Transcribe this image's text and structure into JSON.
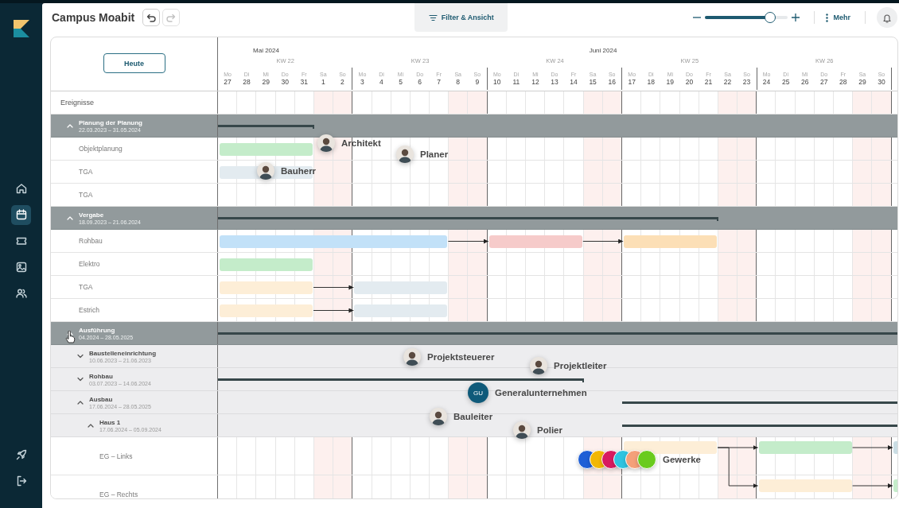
{
  "sidebar": {
    "items": [
      {
        "kind": "home",
        "selected": false
      },
      {
        "kind": "calendar",
        "selected": true
      },
      {
        "kind": "ticket",
        "selected": false
      },
      {
        "kind": "image",
        "selected": false
      },
      {
        "kind": "users",
        "selected": false
      }
    ],
    "bottom_items": [
      {
        "kind": "rocket"
      },
      {
        "kind": "logout"
      }
    ]
  },
  "toolbar": {
    "title": "Campus Moabit",
    "history_buttons": [
      {
        "kind": "undo",
        "disabled": false
      },
      {
        "kind": "redo",
        "disabled": true
      }
    ],
    "filter_button": "Filter & Ansicht",
    "zoom": {
      "level": 0.78
    },
    "more_button": "Mehr"
  },
  "gantt": {
    "today_button": "Heute",
    "months": [
      {
        "label": "Mai 2024"
      },
      {
        "label": "Juni 2024"
      }
    ],
    "weeks": [
      {
        "label": "KW 22",
        "days": [
          {
            "weekday": "Mo",
            "day": "27",
            "weekend": false
          },
          {
            "weekday": "Di",
            "day": "28",
            "weekend": false
          },
          {
            "weekday": "Mi",
            "day": "29",
            "weekend": false
          },
          {
            "weekday": "Do",
            "day": "30",
            "weekend": false
          },
          {
            "weekday": "Fr",
            "day": "31",
            "weekend": false
          },
          {
            "weekday": "Sa",
            "day": "1",
            "weekend": true
          },
          {
            "weekday": "So",
            "day": "2",
            "weekend": true
          }
        ]
      },
      {
        "label": "KW 23",
        "days": [
          {
            "weekday": "Mo",
            "day": "3",
            "weekend": false
          },
          {
            "weekday": "Di",
            "day": "4",
            "weekend": false
          },
          {
            "weekday": "Mi",
            "day": "5",
            "weekend": false
          },
          {
            "weekday": "Do",
            "day": "6",
            "weekend": false
          },
          {
            "weekday": "Fr",
            "day": "7",
            "weekend": false
          },
          {
            "weekday": "Sa",
            "day": "8",
            "weekend": true
          },
          {
            "weekday": "So",
            "day": "9",
            "weekend": true
          }
        ]
      },
      {
        "label": "KW 24",
        "days": [
          {
            "weekday": "Mo",
            "day": "10",
            "weekend": false
          },
          {
            "weekday": "Di",
            "day": "11",
            "weekend": false
          },
          {
            "weekday": "Mi",
            "day": "12",
            "weekend": false
          },
          {
            "weekday": "Do",
            "day": "13",
            "weekend": false
          },
          {
            "weekday": "Fr",
            "day": "14",
            "weekend": false
          },
          {
            "weekday": "Sa",
            "day": "15",
            "weekend": true
          },
          {
            "weekday": "So",
            "day": "16",
            "weekend": true
          }
        ]
      },
      {
        "label": "KW 25",
        "days": [
          {
            "weekday": "Mo",
            "day": "17",
            "weekend": false
          },
          {
            "weekday": "Di",
            "day": "18",
            "weekend": false
          },
          {
            "weekday": "Mi",
            "day": "19",
            "weekend": false
          },
          {
            "weekday": "Do",
            "day": "20",
            "weekend": false
          },
          {
            "weekday": "Fr",
            "day": "21",
            "weekend": false
          },
          {
            "weekday": "Sa",
            "day": "22",
            "weekend": true
          },
          {
            "weekday": "So",
            "day": "23",
            "weekend": true
          }
        ]
      },
      {
        "label": "KW 26",
        "days": [
          {
            "weekday": "Mo",
            "day": "24",
            "weekend": false
          },
          {
            "weekday": "Di",
            "day": "25",
            "weekend": false
          },
          {
            "weekday": "Mi",
            "day": "26",
            "weekend": false
          },
          {
            "weekday": "Do",
            "day": "27",
            "weekend": false
          },
          {
            "weekday": "Fr",
            "day": "28",
            "weekend": false
          },
          {
            "weekday": "Sa",
            "day": "29",
            "weekend": true
          },
          {
            "weekday": "So",
            "day": "30",
            "weekend": true
          }
        ]
      }
    ],
    "events_label": "Ereignisse",
    "rows": [
      {
        "kind": "group",
        "title": "Planung der Planung",
        "dates": "22.03.2023 – 31.05.2024",
        "expanded": true,
        "children": [
          {
            "kind": "task",
            "label": "Objektplanung",
            "bars": [
              {
                "color": "#c4ecca",
                "kind": "start"
              }
            ]
          },
          {
            "kind": "task",
            "label": "TGA",
            "bars": [
              {
                "color": "#e3ebf0",
                "kind": "start"
              }
            ]
          },
          {
            "kind": "task",
            "label": "TGA"
          }
        ]
      },
      {
        "kind": "group",
        "title": "Vergabe",
        "dates": "18.09.2023 – 21.06.2024",
        "expanded": true,
        "children": [
          {
            "kind": "task",
            "label": "Rohbau",
            "bars": [
              {
                "color": "#c2e1f8",
                "kind": "start"
              },
              {
                "color": "#f6cbca",
                "kind": "follow"
              },
              {
                "color": "#fcdfb6",
                "kind": "follow"
              }
            ]
          },
          {
            "kind": "task",
            "label": "Elektro",
            "bars": [
              {
                "color": "#c4ecca",
                "kind": "start"
              }
            ]
          },
          {
            "kind": "task",
            "label": "TGA",
            "bars": [
              {
                "color": "#fdeed7",
                "kind": "start"
              },
              {
                "color": "#e3ebf0",
                "kind": "follow"
              }
            ]
          },
          {
            "kind": "task",
            "label": "Estrich",
            "bars": [
              {
                "color": "#fdeed7",
                "kind": "start"
              },
              {
                "color": "#e3ebf0",
                "kind": "follow"
              }
            ]
          }
        ]
      },
      {
        "kind": "group",
        "title": "Ausführung",
        "dates": "04.2024 – 28.05.2025",
        "expanded": true,
        "children": [
          {
            "kind": "subgroup",
            "title": "Baustelleneinrichtung",
            "dates": "10.06.2023 – 21.06.2023",
            "expanded": false
          },
          {
            "kind": "subgroup",
            "title": "Rohbau",
            "dates": "03.07.2023 – 14.06.2024",
            "expanded": false
          },
          {
            "kind": "subgroup",
            "title": "Ausbau",
            "dates": "17.06.2024 – 28.05.2025",
            "expanded": true,
            "children": [
              {
                "kind": "subgroup",
                "title": "Haus 1",
                "dates": "17.06.2024 – 05.09.2024",
                "expanded": true,
                "children": [
                  {
                    "kind": "lane",
                    "label": "EG – Links",
                    "bars": [
                      {
                        "color": "#fdeed7",
                        "kind": "start"
                      },
                      {
                        "color": "#c4ecca",
                        "kind": "follow"
                      },
                      {
                        "color": "#cadde4",
                        "kind": "follow"
                      }
                    ]
                  },
                  {
                    "kind": "lane",
                    "label": "EG – Rechts",
                    "bars": [
                      {
                        "color": "#fdeed7",
                        "kind": "branch"
                      },
                      {
                        "color": "#c4ecca",
                        "kind": "follow"
                      }
                    ]
                  }
                ]
              }
            ]
          }
        ]
      }
    ]
  },
  "people": [
    {
      "kind": "photo",
      "label": "Architekt"
    },
    {
      "kind": "photo",
      "label": "Planer"
    },
    {
      "kind": "photo",
      "label": "Bauherr"
    },
    {
      "kind": "photo",
      "label": "Projektsteuerer"
    },
    {
      "kind": "photo",
      "label": "Projektleiter"
    },
    {
      "kind": "initials",
      "initials": "GU",
      "label": "Generalunternehmen"
    },
    {
      "kind": "photo",
      "label": "Bauleiter"
    },
    {
      "kind": "photo",
      "label": "Polier"
    },
    {
      "kind": "group",
      "label": "Gewerke",
      "members": [
        {
          "color": "#1f5fd6"
        },
        {
          "color": "#f2b705"
        },
        {
          "color": "#d81b60"
        },
        {
          "color": "#2fc3e0"
        },
        {
          "color": "#f4a07a"
        },
        {
          "color": "#6acb1e"
        }
      ]
    }
  ]
}
